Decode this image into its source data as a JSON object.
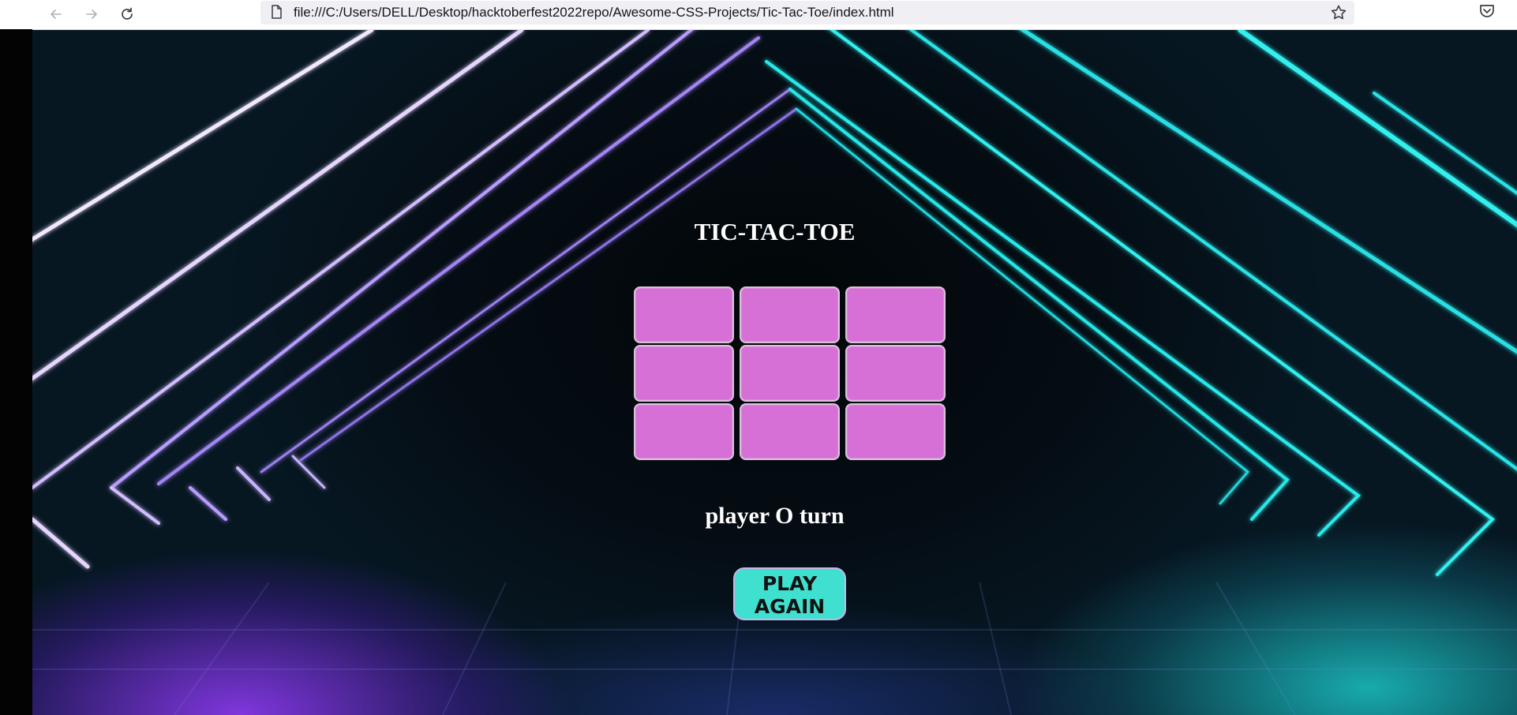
{
  "browser": {
    "url": "file:///C:/Users/DELL/Desktop/hacktoberfest2022repo/Awesome-CSS-Projects/Tic-Tac-Toe/index.html",
    "icons": [
      "back-arrow-icon",
      "forward-arrow-icon",
      "reload-icon",
      "page-icon",
      "bookmark-star-icon",
      "pocket-icon"
    ]
  },
  "game": {
    "title": "TIC-TAC-TOE",
    "cells": [
      "",
      "",
      "",
      "",
      "",
      "",
      "",
      "",
      ""
    ],
    "status": "player O turn",
    "play_again_line1": "PLAY",
    "play_again_line2": "AGAIN"
  },
  "colors": {
    "cell": "#d670d6",
    "button": "#40e0d0",
    "text": "#ffffff"
  }
}
